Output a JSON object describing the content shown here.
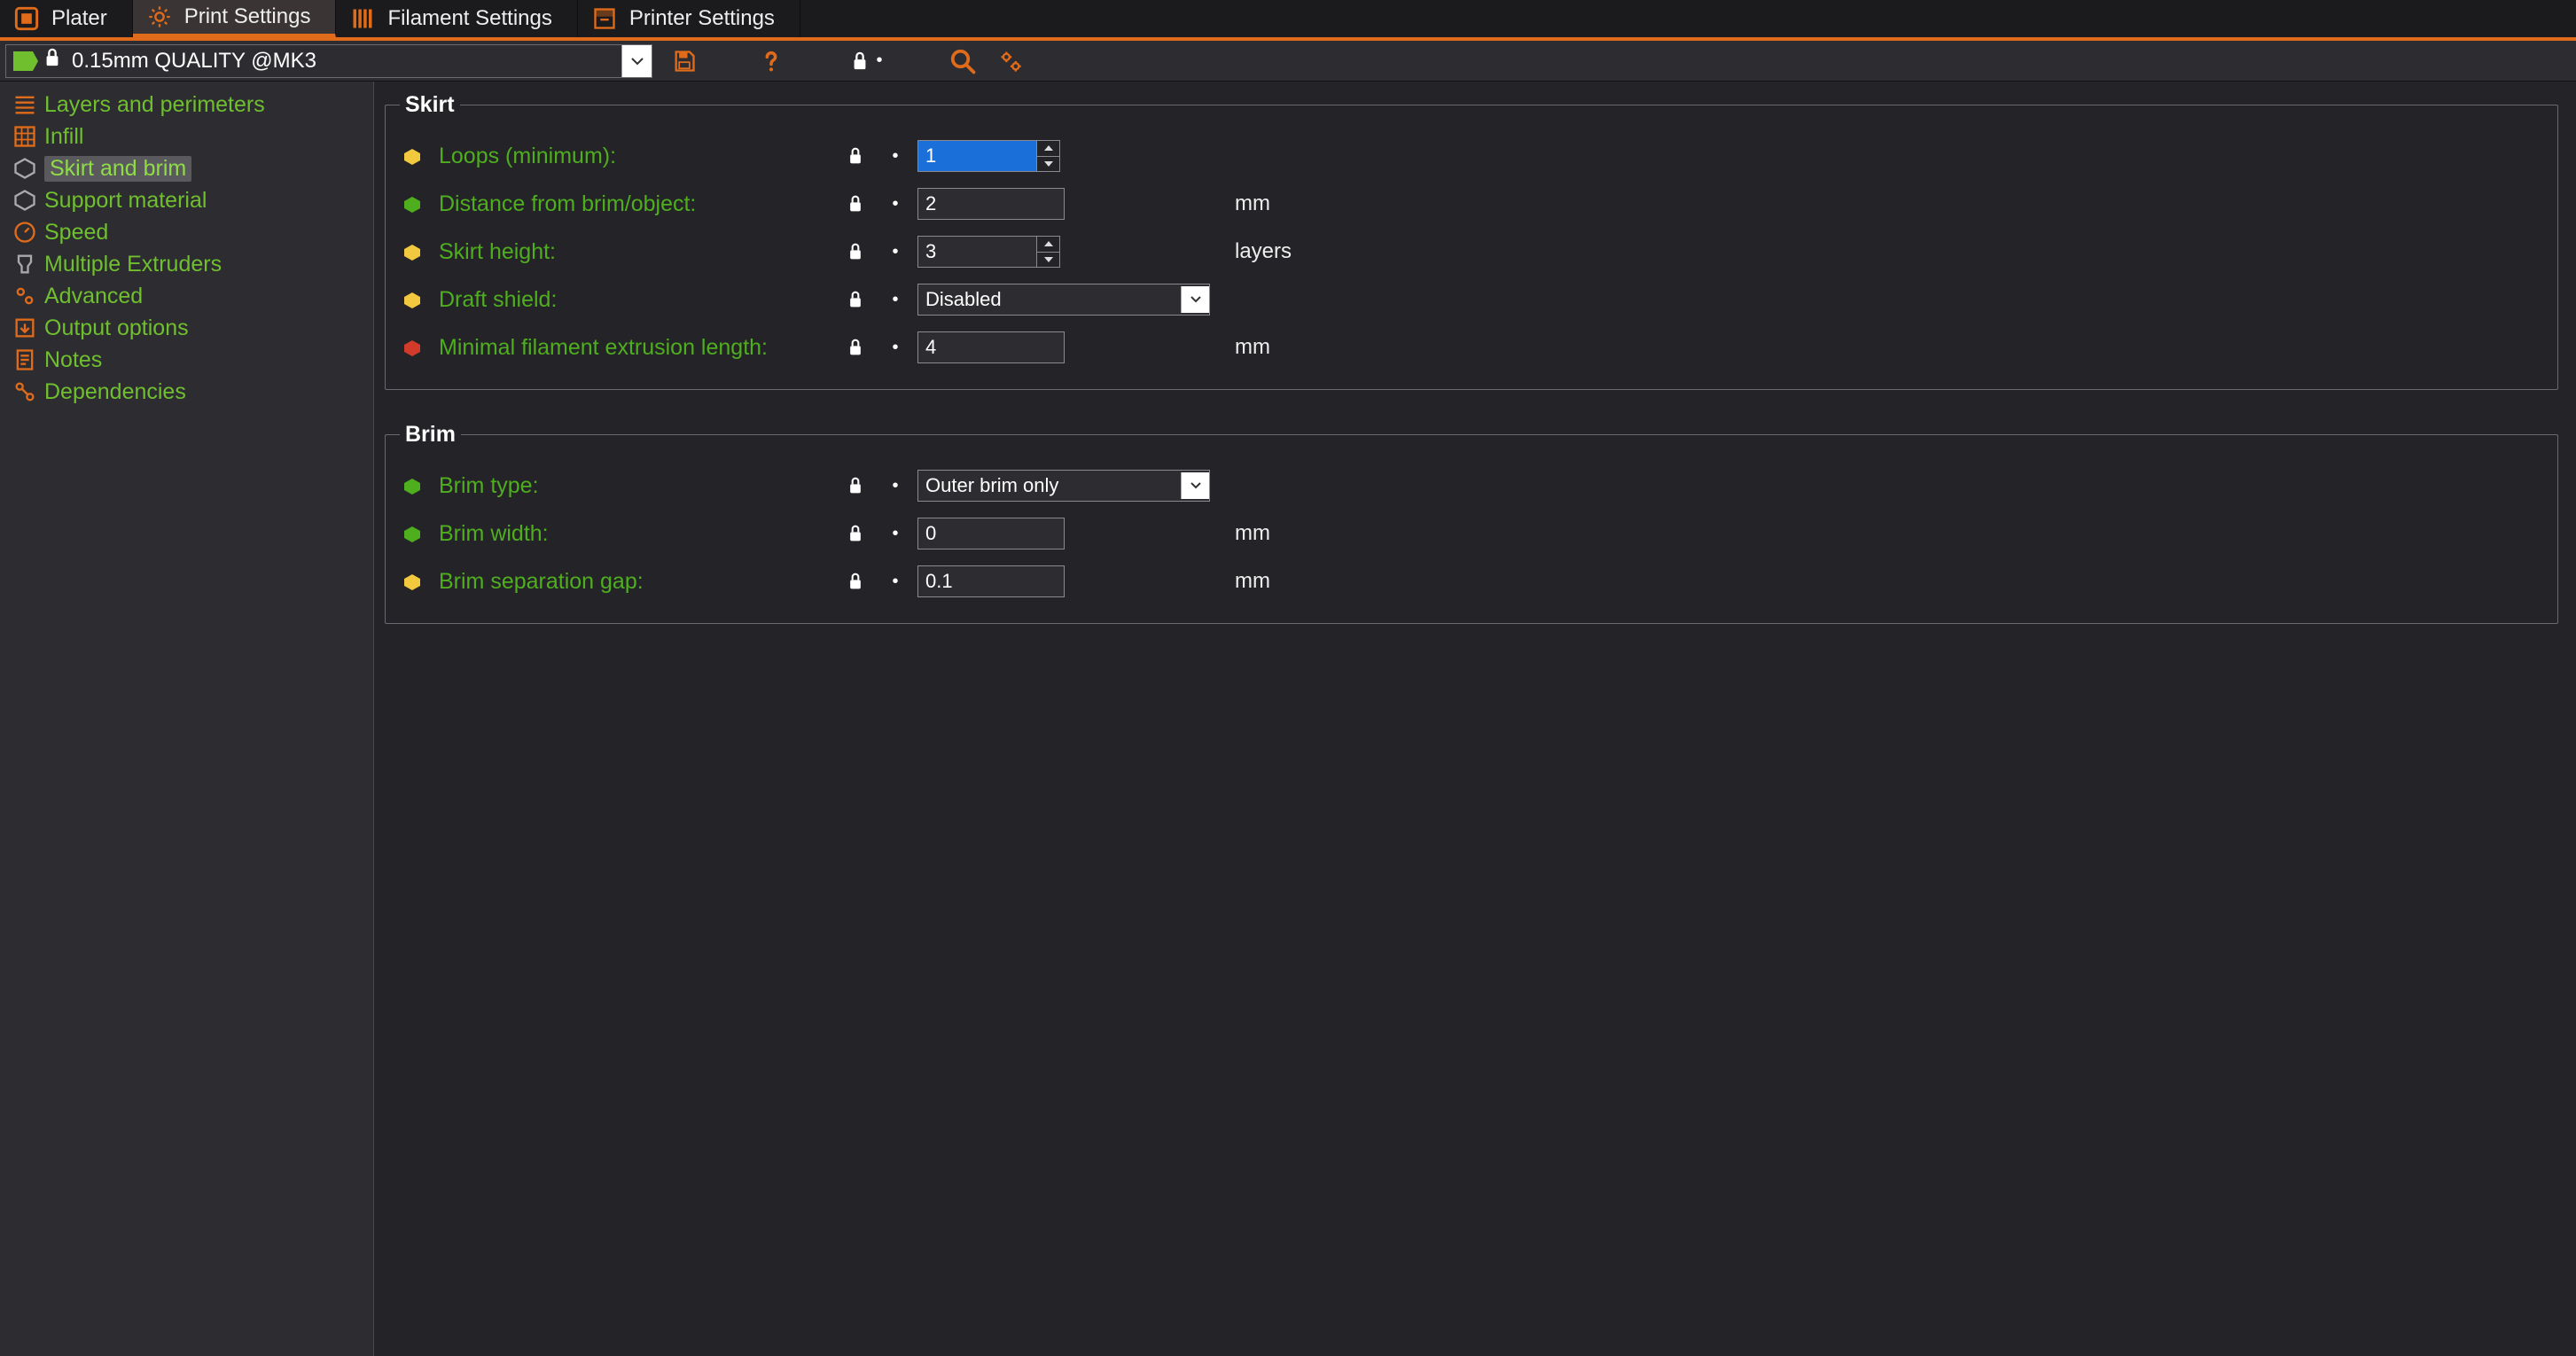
{
  "tabs": [
    {
      "id": "plater",
      "label": "Plater"
    },
    {
      "id": "print-settings",
      "label": "Print Settings"
    },
    {
      "id": "filament-settings",
      "label": "Filament Settings"
    },
    {
      "id": "printer-settings",
      "label": "Printer Settings"
    }
  ],
  "active_tab": 1,
  "preset": {
    "name": "0.15mm QUALITY @MK3"
  },
  "sidebar": {
    "items": [
      {
        "id": "layers",
        "label": "Layers and perimeters"
      },
      {
        "id": "infill",
        "label": "Infill"
      },
      {
        "id": "skirt",
        "label": "Skirt and brim"
      },
      {
        "id": "support",
        "label": "Support material"
      },
      {
        "id": "speed",
        "label": "Speed"
      },
      {
        "id": "multi",
        "label": "Multiple Extruders"
      },
      {
        "id": "advanced",
        "label": "Advanced"
      },
      {
        "id": "output",
        "label": "Output options"
      },
      {
        "id": "notes",
        "label": "Notes"
      },
      {
        "id": "deps",
        "label": "Dependencies"
      }
    ],
    "selected": 2
  },
  "groups": {
    "skirt": {
      "title": "Skirt",
      "rows": {
        "loops": {
          "label": "Loops (minimum):",
          "value": "1",
          "unit": "",
          "bullet": "yellow",
          "type": "spin",
          "selected": true
        },
        "distance": {
          "label": "Distance from brim/object:",
          "value": "2",
          "unit": "mm",
          "bullet": "green",
          "type": "text"
        },
        "height": {
          "label": "Skirt height:",
          "value": "3",
          "unit": "layers",
          "bullet": "yellow",
          "type": "spin"
        },
        "draft": {
          "label": "Draft shield:",
          "value": "Disabled",
          "unit": "",
          "bullet": "yellow",
          "type": "select"
        },
        "minlen": {
          "label": "Minimal filament extrusion length:",
          "value": "4",
          "unit": "mm",
          "bullet": "red",
          "type": "text"
        }
      }
    },
    "brim": {
      "title": "Brim",
      "rows": {
        "type": {
          "label": "Brim type:",
          "value": "Outer brim only",
          "unit": "",
          "bullet": "green",
          "type": "select"
        },
        "width": {
          "label": "Brim width:",
          "value": "0",
          "unit": "mm",
          "bullet": "green",
          "type": "text"
        },
        "gap": {
          "label": "Brim separation gap:",
          "value": "0.1",
          "unit": "mm",
          "bullet": "yellow",
          "type": "text"
        }
      }
    }
  },
  "colors": {
    "accent": "#e06b1a",
    "green": "#4fae1e",
    "yellow": "#f2c83f",
    "red": "#d23a2a"
  }
}
